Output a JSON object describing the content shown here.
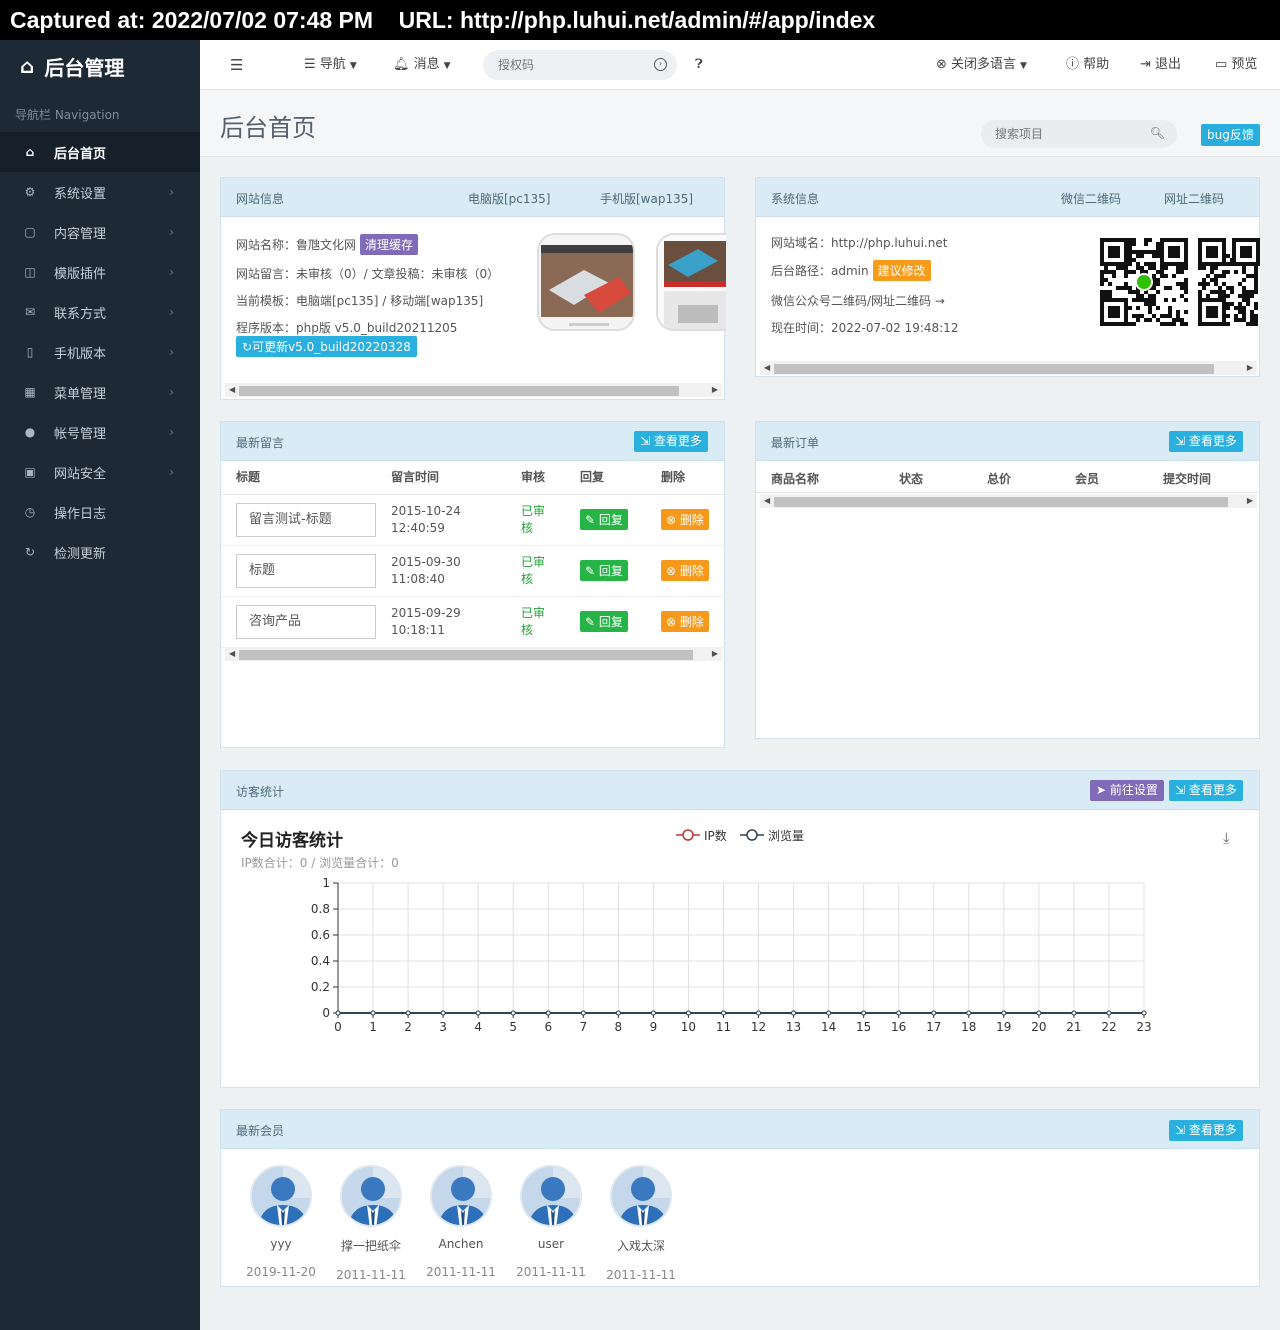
{
  "capture": {
    "text": "Captured at: 2022/07/02 07:48 PM    URL: http://php.luhui.net/admin/#/app/index"
  },
  "sidebar": {
    "brand": "后台管理",
    "nav_label": "导航栏 Navigation",
    "items": [
      {
        "label": "后台首页",
        "icon": "home-icon",
        "glyph": "⌂"
      },
      {
        "label": "系统设置",
        "icon": "gear-icon",
        "glyph": "⚙"
      },
      {
        "label": "内容管理",
        "icon": "file-icon",
        "glyph": "▢"
      },
      {
        "label": "模版插件",
        "icon": "bookmark-icon",
        "glyph": "◫"
      },
      {
        "label": "联系方式",
        "icon": "envelope-icon",
        "glyph": "✉"
      },
      {
        "label": "手机版本",
        "icon": "mobile-icon",
        "glyph": "▯"
      },
      {
        "label": "菜单管理",
        "icon": "grid-icon",
        "glyph": "▦"
      },
      {
        "label": "帐号管理",
        "icon": "user-icon",
        "glyph": "●"
      },
      {
        "label": "网站安全",
        "icon": "lock-icon",
        "glyph": "▣"
      },
      {
        "label": "操作日志",
        "icon": "clock-icon",
        "glyph": "◷"
      },
      {
        "label": "检测更新",
        "icon": "refresh-icon",
        "glyph": "↻"
      }
    ]
  },
  "topbar": {
    "nav": "导航",
    "messages": "消息",
    "auth_placeholder": "授权码",
    "lang": "关闭多语言",
    "help": "帮助",
    "logout": "退出",
    "preview": "预览"
  },
  "page": {
    "title": "后台首页",
    "search_placeholder": "搜索项目",
    "bug": "bug反馈"
  },
  "site_info": {
    "title": "网站信息",
    "pc_link": "电脑版[pc135]",
    "wap_link": "手机版[wap135]",
    "name": "网站名称：鲁虺文化网",
    "clear_cache": "清理缓存",
    "messages": "网站留言：未审核（0）/ 文章投稿：未审核（0）",
    "template": "当前模板：电脑端[pc135] / 移动端[wap135]",
    "version": "程序版本：php版 v5.0_build20211205",
    "update": "可更新v5.0_build20220328"
  },
  "sys_info": {
    "title": "系统信息",
    "wechat_qr": "微信二维码",
    "url_qr": "网址二维码",
    "domain": "网站域名：http://php.luhui.net",
    "path": "后台路径：admin",
    "suggest": "建议修改",
    "qr_note": "微信公众号二维码/网址二维码 →",
    "now": "现在时间：2022-07-02 19:48:12"
  },
  "messages": {
    "title": "最新留言",
    "more": "查看更多",
    "headers": [
      "标题",
      "留言时间",
      "审核",
      "回复",
      "删除"
    ],
    "rows": [
      {
        "title": "留言测试-标题",
        "date": "2015-10-24",
        "time": "12:40:59",
        "status": "已审核",
        "reply": "回复",
        "del": "删除"
      },
      {
        "title": "标题",
        "date": "2015-09-30",
        "time": "11:08:40",
        "status": "已审核",
        "reply": "回复",
        "del": "删除"
      },
      {
        "title": "咨询产品",
        "date": "2015-09-29",
        "time": "10:18:11",
        "status": "已审核",
        "reply": "回复",
        "del": "删除"
      }
    ]
  },
  "orders": {
    "title": "最新订单",
    "more": "查看更多",
    "headers": [
      "商品名称",
      "状态",
      "总价",
      "会员",
      "提交时间"
    ]
  },
  "visitors": {
    "title": "访客统计",
    "settings": "前往设置",
    "more": "查看更多",
    "chart_title": "今日访客统计",
    "chart_sub": "IP数合计：0 / 浏览量合计：0"
  },
  "chart_data": {
    "type": "line",
    "title": "今日访客统计",
    "x": [
      0,
      1,
      2,
      3,
      4,
      5,
      6,
      7,
      8,
      9,
      10,
      11,
      12,
      13,
      14,
      15,
      16,
      17,
      18,
      19,
      20,
      21,
      22,
      23
    ],
    "series": [
      {
        "name": "IP数",
        "color": "#c23531",
        "values": [
          0,
          0,
          0,
          0,
          0,
          0,
          0,
          0,
          0,
          0,
          0,
          0,
          0,
          0,
          0,
          0,
          0,
          0,
          0,
          0,
          0,
          0,
          0,
          0
        ]
      },
      {
        "name": "浏览量",
        "color": "#2f4554",
        "values": [
          0,
          0,
          0,
          0,
          0,
          0,
          0,
          0,
          0,
          0,
          0,
          0,
          0,
          0,
          0,
          0,
          0,
          0,
          0,
          0,
          0,
          0,
          0,
          0
        ]
      }
    ],
    "ylim": [
      0,
      1
    ],
    "yticks": [
      "0",
      "0.2",
      "0.4",
      "0.6",
      "0.8",
      "1"
    ],
    "grid": true,
    "legend": "top-center"
  },
  "members": {
    "title": "最新会员",
    "more": "查看更多",
    "list": [
      {
        "name": "yyy",
        "date": "2019-11-20"
      },
      {
        "name": "撑一把纸伞",
        "date": "2011-11-11"
      },
      {
        "name": "Anchen",
        "date": "2011-11-11"
      },
      {
        "name": "user",
        "date": "2011-11-11"
      },
      {
        "name": "入戏太深",
        "date": "2011-11-11"
      }
    ]
  }
}
